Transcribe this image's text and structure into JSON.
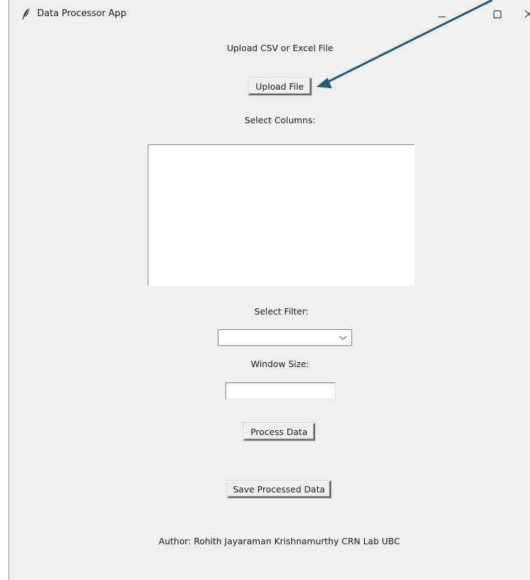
{
  "window": {
    "title": "Data Processor App"
  },
  "main": {
    "upload_prompt": "Upload CSV or Excel File",
    "upload_button": "Upload File",
    "columns_label": "Select Columns:",
    "filter_label": "Select Filter:",
    "filter_value": "",
    "window_size_label": "Window Size:",
    "window_size_value": "",
    "process_button": "Process Data",
    "save_button": "Save Processed Data",
    "author_text": "Author: Rohith Jayaraman Krishnamurthy  CRN Lab UBC"
  },
  "icons": {
    "app": "feather-icon",
    "minimize": "minimize-icon",
    "maximize": "maximize-icon",
    "close": "close-icon",
    "dropdown": "chevron-down-icon"
  },
  "colors": {
    "window_bg": "#f0f0f0",
    "annotation_arrow": "#1f5a7a"
  }
}
